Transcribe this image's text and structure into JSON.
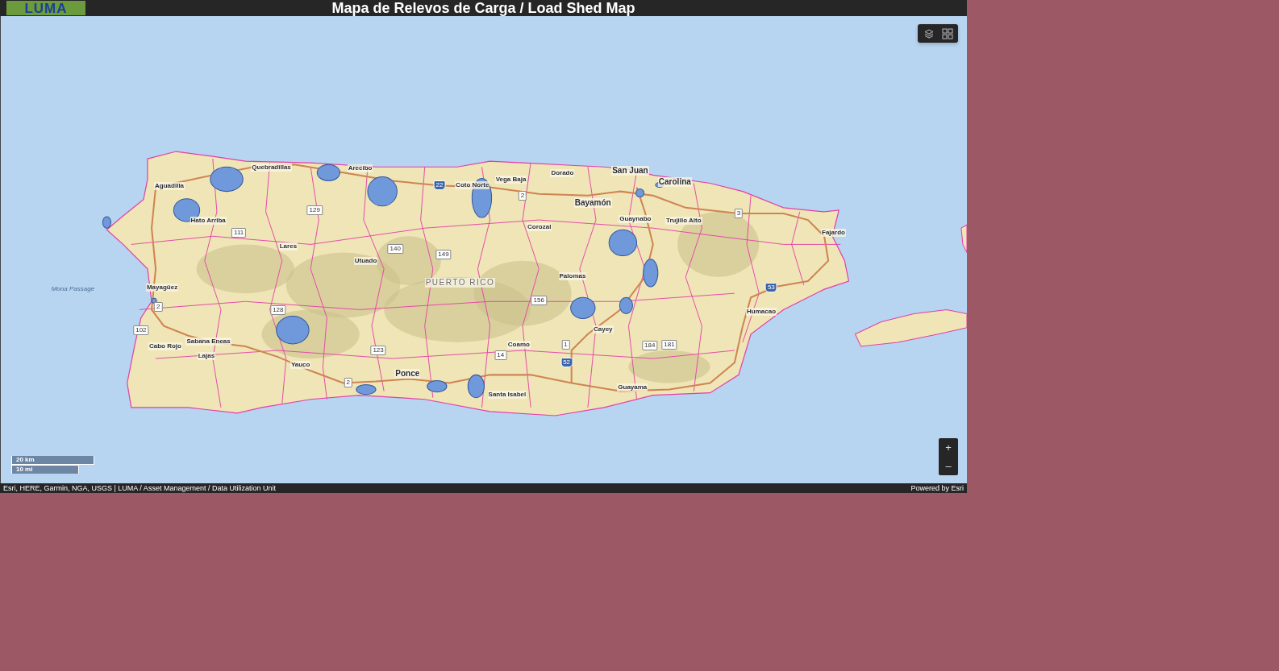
{
  "header": {
    "logo": "LUMA",
    "title": "Mapa de Relevos de Carga / Load Shed Map"
  },
  "map": {
    "labels": [
      {
        "text": "Quebradillas",
        "kind": "town"
      },
      {
        "text": "Arecibo",
        "kind": "town"
      },
      {
        "text": "Aguadilla",
        "kind": "town"
      },
      {
        "text": "Vega Baja",
        "kind": "town"
      },
      {
        "text": "Dorado",
        "kind": "town"
      },
      {
        "text": "San Juan",
        "kind": "city"
      },
      {
        "text": "Carolina",
        "kind": "city"
      },
      {
        "text": "Coto Norte",
        "kind": "town"
      },
      {
        "text": "Bayamón",
        "kind": "city"
      },
      {
        "text": "Hato Arriba",
        "kind": "town"
      },
      {
        "text": "Guaynabo",
        "kind": "town"
      },
      {
        "text": "Trujillo Alto",
        "kind": "town"
      },
      {
        "text": "Corozal",
        "kind": "town"
      },
      {
        "text": "Fajardo",
        "kind": "town"
      },
      {
        "text": "Lares",
        "kind": "town"
      },
      {
        "text": "Utuado",
        "kind": "town"
      },
      {
        "text": "Palomas",
        "kind": "town"
      },
      {
        "text": "PUERTO RICO",
        "kind": "region"
      },
      {
        "text": "Mona Passage",
        "kind": "water"
      },
      {
        "text": "Mayagüez",
        "kind": "town"
      },
      {
        "text": "Humacao",
        "kind": "town"
      },
      {
        "text": "Cayey",
        "kind": "town"
      },
      {
        "text": "Sabana Eneas",
        "kind": "town"
      },
      {
        "text": "Cabo Rojo",
        "kind": "town"
      },
      {
        "text": "Coamo",
        "kind": "town"
      },
      {
        "text": "Lajas",
        "kind": "town"
      },
      {
        "text": "Yauco",
        "kind": "town"
      },
      {
        "text": "Ponce",
        "kind": "city"
      },
      {
        "text": "Guayama",
        "kind": "town"
      },
      {
        "text": "Santa Isabel",
        "kind": "town"
      }
    ],
    "shields": [
      {
        "text": "129",
        "kind": "highway"
      },
      {
        "text": "111",
        "kind": "highway"
      },
      {
        "text": "22",
        "kind": "interstate"
      },
      {
        "text": "2",
        "kind": "highway"
      },
      {
        "text": "140",
        "kind": "highway"
      },
      {
        "text": "149",
        "kind": "highway"
      },
      {
        "text": "128",
        "kind": "highway"
      },
      {
        "text": "2",
        "kind": "highway"
      },
      {
        "text": "102",
        "kind": "highway"
      },
      {
        "text": "156",
        "kind": "highway"
      },
      {
        "text": "3",
        "kind": "highway"
      },
      {
        "text": "123",
        "kind": "highway"
      },
      {
        "text": "14",
        "kind": "highway"
      },
      {
        "text": "1",
        "kind": "highway"
      },
      {
        "text": "52",
        "kind": "interstate"
      },
      {
        "text": "184",
        "kind": "highway"
      },
      {
        "text": "181",
        "kind": "highway"
      },
      {
        "text": "53",
        "kind": "interstate"
      },
      {
        "text": "2",
        "kind": "highway"
      }
    ],
    "scale_bar": {
      "metric": "20 km",
      "imperial": "10 mi"
    },
    "zoom_in": "+",
    "zoom_out": "–"
  },
  "footer": {
    "attribution": "Esri, HERE, Garmin, NGA, USGS | LUMA / Asset Management / Data Utilization Unit",
    "powered_by": "Powered by Esri"
  }
}
